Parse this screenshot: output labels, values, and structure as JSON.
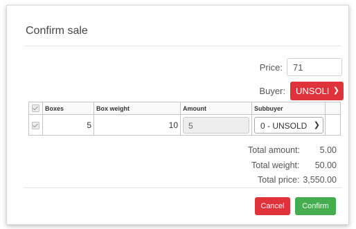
{
  "dialog": {
    "title": "Confirm sale"
  },
  "form": {
    "price_label": "Price:",
    "price_value": "71",
    "buyer_label": "Buyer:",
    "buyer_value": "UNSOLI"
  },
  "table": {
    "columns": [
      "",
      "Boxes",
      "Box weight",
      "Amount",
      "Subbuyer",
      ""
    ],
    "rows": [
      {
        "checked": true,
        "boxes": "5",
        "box_weight": "10",
        "amount": "5",
        "subbuyer": "0 - UNSOLD"
      }
    ]
  },
  "totals": {
    "amount_label": "Total amount:",
    "amount_value": "5.00",
    "weight_label": "Total weight:",
    "weight_value": "50.00",
    "price_label": "Total price:",
    "price_value": "3,550.00"
  },
  "actions": {
    "cancel_label": "Cancel",
    "confirm_label": "Confirm"
  },
  "colors": {
    "danger": "#e0323b",
    "success": "#45ad4f"
  },
  "icons": {
    "buyer_dropdown": "chevron-down-icon",
    "subbuyer_dropdown": "chevron-down-icon",
    "row_checkbox": "checkbox-icon"
  }
}
